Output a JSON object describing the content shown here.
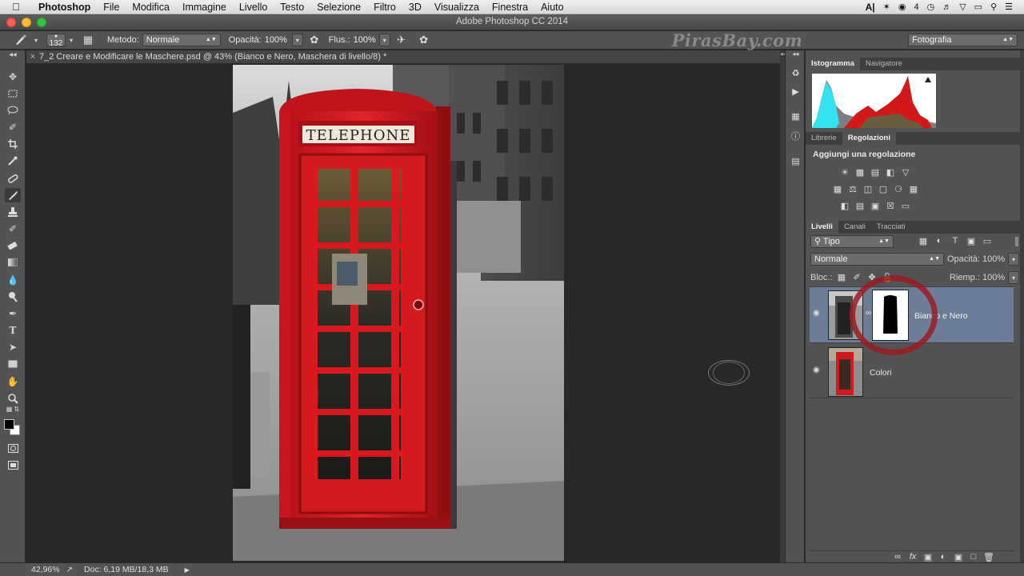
{
  "menubar": {
    "items": [
      "Photoshop",
      "File",
      "Modifica",
      "Immagine",
      "Livello",
      "Testo",
      "Selezione",
      "Filtro",
      "3D",
      "Visualizza",
      "Finestra",
      "Aiuto"
    ],
    "battery_count": "4"
  },
  "window": {
    "title": "Adobe Photoshop CC 2014"
  },
  "options_bar": {
    "brush_size": "132",
    "method_label": "Metodo:",
    "method_value": "Normale",
    "opacity_label": "Opacità:",
    "opacity_value": "100%",
    "flow_label": "Flus.:",
    "flow_value": "100%",
    "watermark": "PirasBay.com",
    "workspace": "Fotografia"
  },
  "document": {
    "tab_title": "7_2 Creare e Modificare le Maschere.psd @ 43% (Bianco e Nero, Maschera di livello/8) *",
    "phone_sign": "TELEPHONE"
  },
  "histogram": {
    "tabs": [
      "Istogramma",
      "Navigatore"
    ],
    "active_tab": "Istogramma"
  },
  "adjustments": {
    "tabs": [
      "Librerie",
      "Regolazioni"
    ],
    "active_tab": "Regolazioni",
    "title": "Aggiungi una regolazione"
  },
  "layers_panel": {
    "tabs": [
      "Livelli",
      "Canali",
      "Tracciati"
    ],
    "active_tab": "Livelli",
    "filter_kind": "Tipo",
    "blend_mode": "Normale",
    "opacity_label": "Opacità:",
    "opacity_value": "100%",
    "lock_label": "Bloc.:",
    "fill_label": "Riemp.:",
    "fill_value": "100%",
    "layers": [
      {
        "name": "Bianco e Nero",
        "selected": true,
        "has_mask": true
      },
      {
        "name": "Colori",
        "selected": false,
        "has_mask": false
      }
    ]
  },
  "status_bar": {
    "zoom": "42,96%",
    "doc_size": "Doc: 6,19 MB/18,3 MB"
  },
  "colors": {
    "panel_bg": "#535353",
    "canvas_bg": "#282828",
    "selected_layer": "#6d7d98",
    "phone_red": "#d2161c",
    "mask_circle": "#9b1b23"
  }
}
